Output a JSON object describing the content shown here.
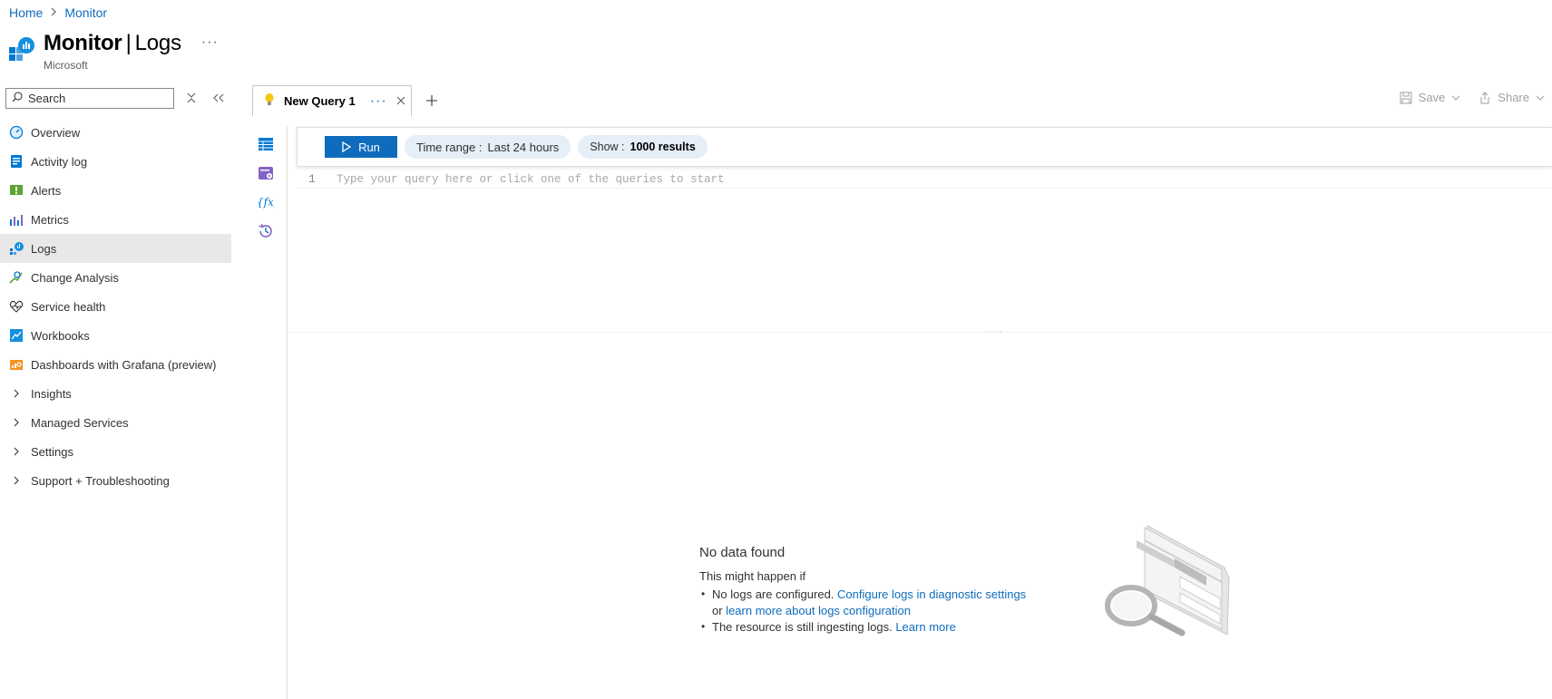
{
  "breadcrumb": {
    "home": "Home",
    "monitor": "Monitor"
  },
  "header": {
    "title": "Monitor",
    "separator": "|",
    "subtitle": "Logs",
    "org": "Microsoft",
    "more": "···"
  },
  "sidebar": {
    "search_placeholder": "Search",
    "items": [
      {
        "label": "Overview",
        "icon": "overview-icon"
      },
      {
        "label": "Activity log",
        "icon": "activity-log-icon"
      },
      {
        "label": "Alerts",
        "icon": "alerts-icon"
      },
      {
        "label": "Metrics",
        "icon": "metrics-icon"
      },
      {
        "label": "Logs",
        "icon": "logs-icon",
        "selected": true
      },
      {
        "label": "Change Analysis",
        "icon": "change-analysis-icon"
      },
      {
        "label": "Service health",
        "icon": "service-health-icon"
      },
      {
        "label": "Workbooks",
        "icon": "workbooks-icon"
      },
      {
        "label": "Dashboards with Grafana (preview)",
        "icon": "grafana-icon"
      }
    ],
    "groups": [
      {
        "label": "Insights"
      },
      {
        "label": "Managed Services"
      },
      {
        "label": "Settings"
      },
      {
        "label": "Support + Troubleshooting"
      }
    ]
  },
  "tabs": {
    "active": "New Query 1"
  },
  "toolbar": {
    "save": "Save",
    "share": "Share",
    "run": "Run",
    "time_range_label": "Time range :",
    "time_range_value": "Last 24 hours",
    "show_label": "Show :",
    "show_value": "1000 results"
  },
  "editor": {
    "line_number": "1",
    "placeholder": "Type your query here or click one of the queries to start"
  },
  "empty_state": {
    "title": "No data found",
    "subtitle": "This might happen if",
    "bullet1_text": "No logs are configured.",
    "bullet1_link": "Configure logs in diagnostic settings",
    "bullet1_or": "or",
    "bullet1_link2": "learn more about logs configuration",
    "bullet2_text": "The resource is still ingesting logs.",
    "bullet2_link": "Learn more"
  },
  "colors": {
    "accent": "#0f6cbd",
    "selected_bg": "#e8e8e8",
    "pill_bg": "#e6eef8"
  }
}
